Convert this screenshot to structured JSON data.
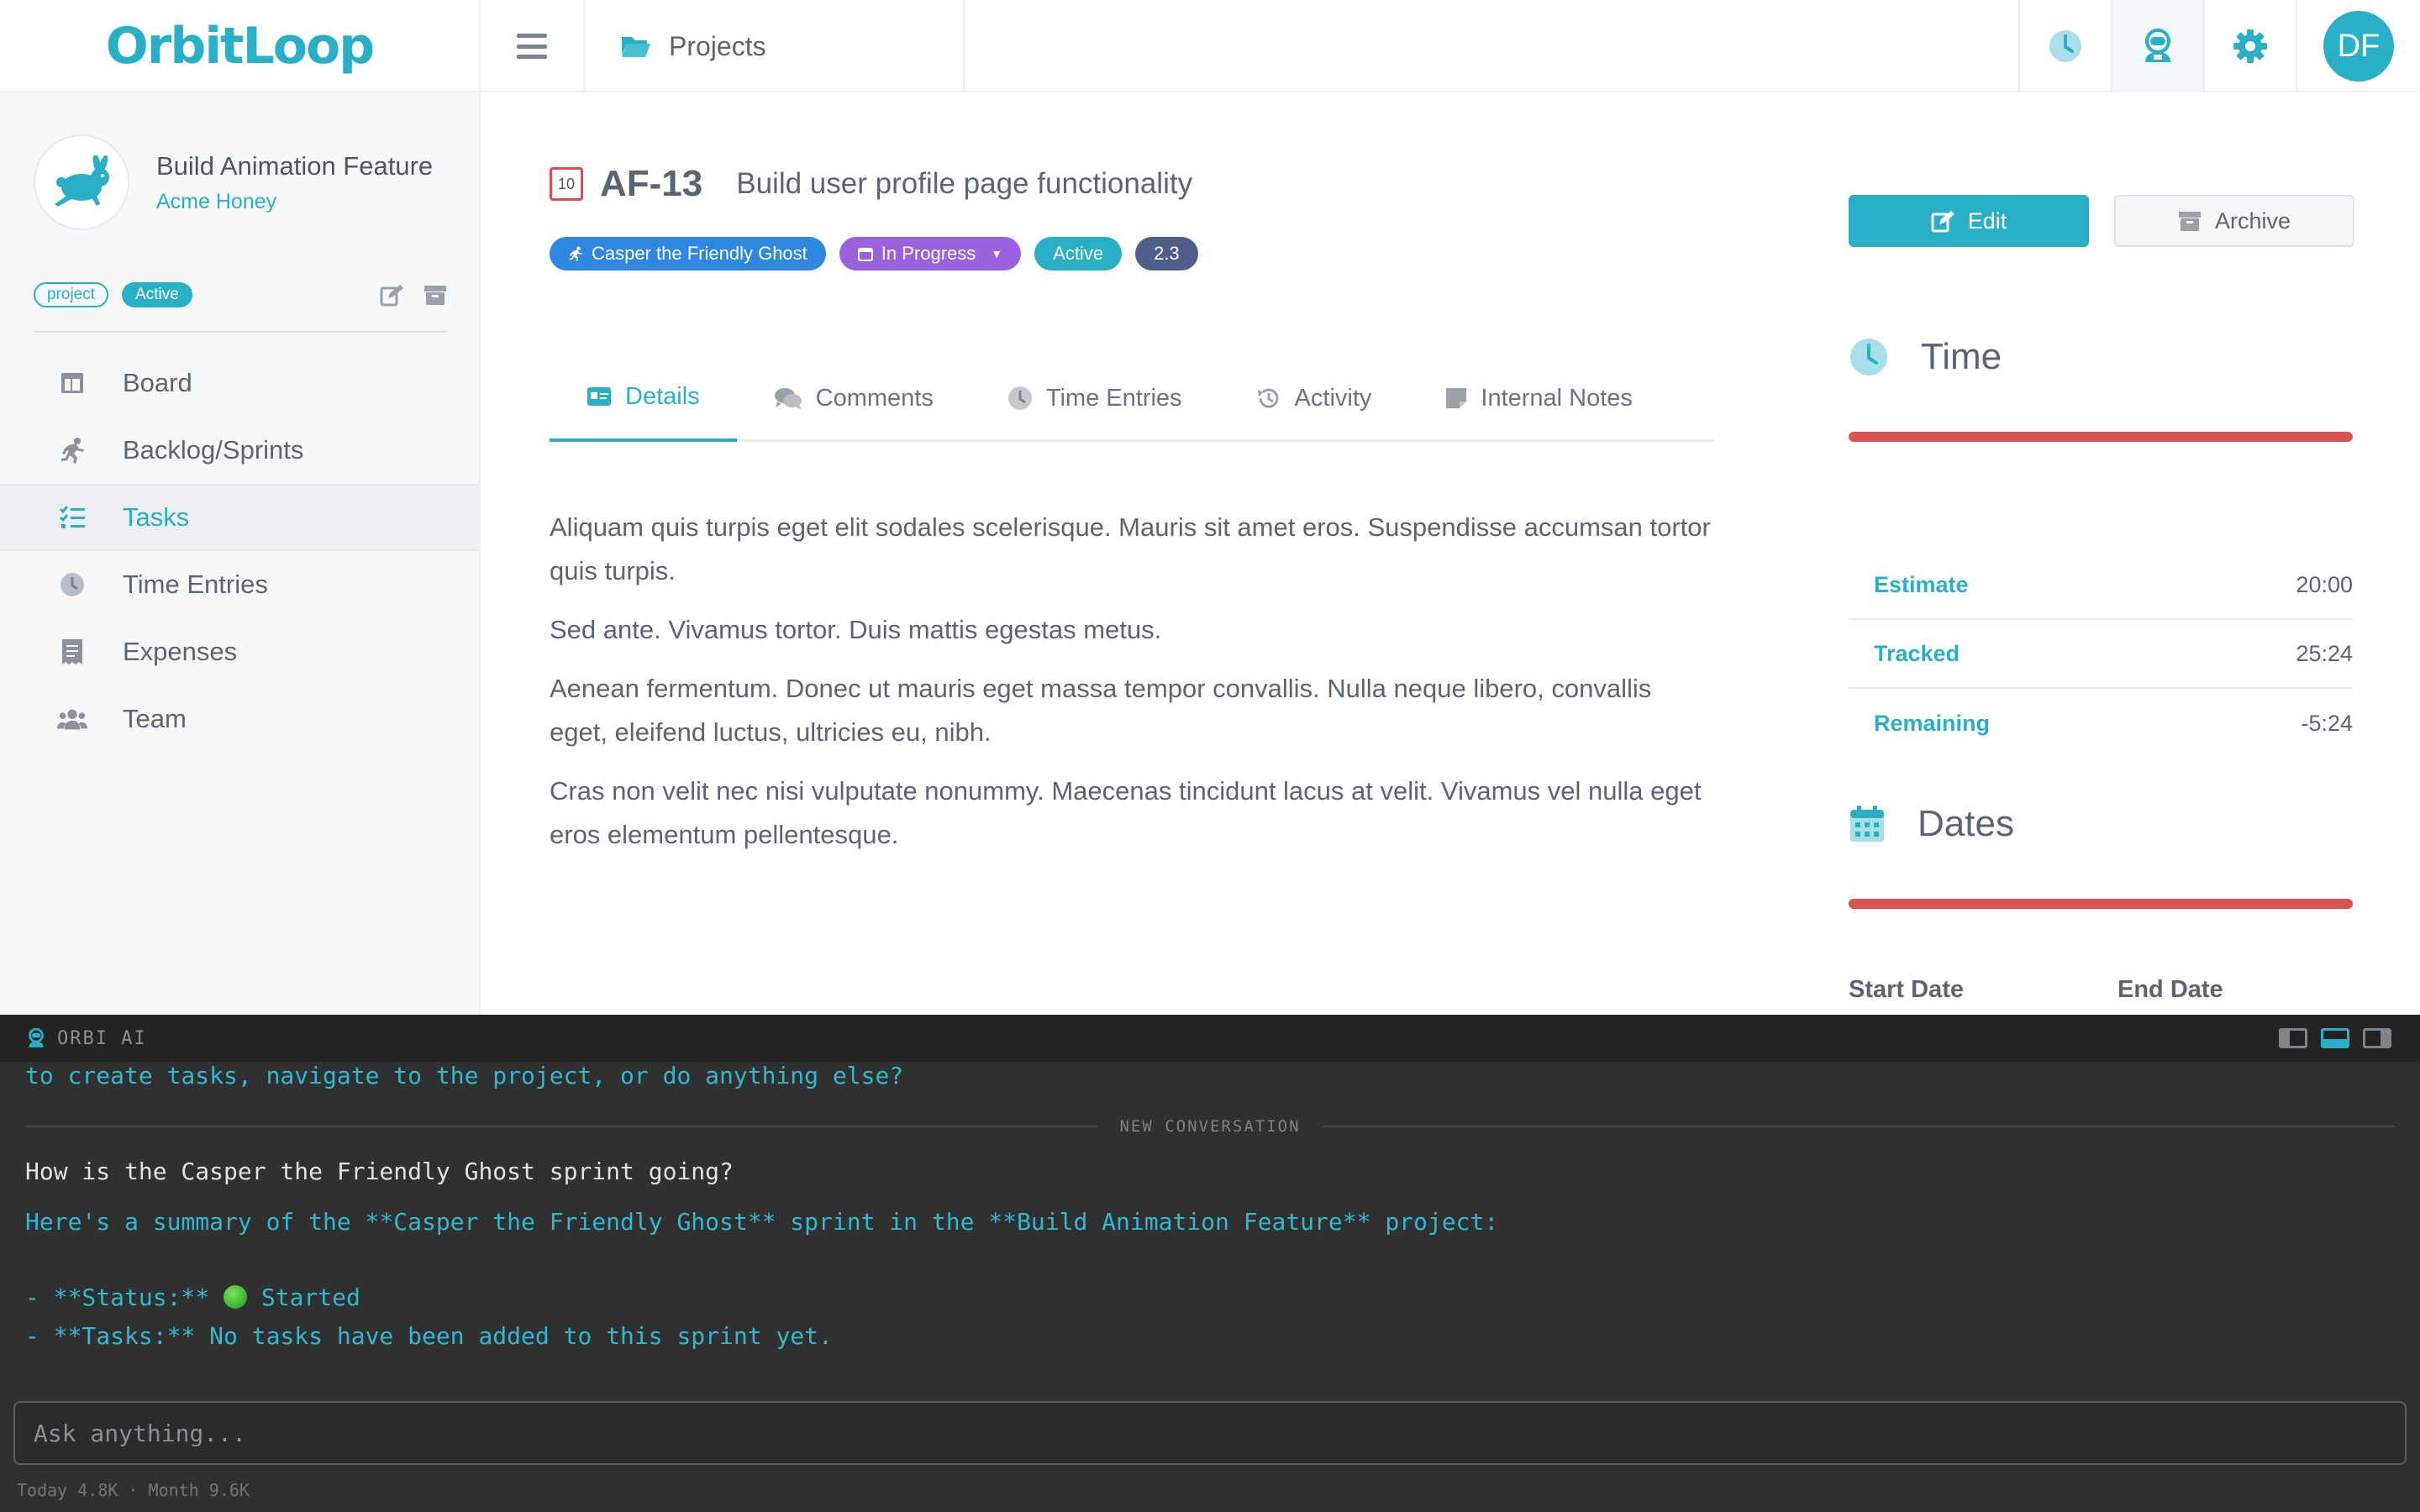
{
  "app": {
    "logo": "OrbitLoop"
  },
  "topbar": {
    "breadcrumb": "Projects",
    "icons": [
      "clock-icon",
      "astronaut-icon",
      "gear-icon"
    ],
    "avatar_initials": "DF"
  },
  "project": {
    "name": "Build Animation Feature",
    "client": "Acme Honey",
    "tag_type": "project",
    "tag_status": "Active"
  },
  "sidebar": {
    "items": [
      {
        "label": "Board",
        "icon": "board-icon"
      },
      {
        "label": "Backlog/Sprints",
        "icon": "running-icon"
      },
      {
        "label": "Tasks",
        "icon": "tasks-icon",
        "active": true
      },
      {
        "label": "Time Entries",
        "icon": "clock-icon"
      },
      {
        "label": "Expenses",
        "icon": "receipt-icon"
      },
      {
        "label": "Team",
        "icon": "team-icon"
      }
    ]
  },
  "task": {
    "priority": "10",
    "key": "AF-13",
    "title": "Build user profile page functionality",
    "sprint_badge": "Casper the Friendly Ghost",
    "status_badge": "In Progress",
    "active_badge": "Active",
    "points_badge": "2.3"
  },
  "tabs": [
    {
      "label": "Details",
      "active": true
    },
    {
      "label": "Comments"
    },
    {
      "label": "Time Entries"
    },
    {
      "label": "Activity"
    },
    {
      "label": "Internal Notes"
    }
  ],
  "description": [
    "Aliquam quis turpis eget elit sodales scelerisque. Mauris sit amet eros. Suspendisse accumsan tortor quis turpis.",
    "Sed ante. Vivamus tortor. Duis mattis egestas metus.",
    "Aenean fermentum. Donec ut mauris eget massa tempor convallis. Nulla neque libero, convallis eget, eleifend luctus, ultricies eu, nibh.",
    "Cras non velit nec nisi vulputate nonummy. Maecenas tincidunt lacus at velit. Vivamus vel nulla eget eros elementum pellentesque."
  ],
  "actions": {
    "edit": "Edit",
    "archive": "Archive"
  },
  "time_panel": {
    "title": "Time",
    "rows": [
      {
        "label": "Estimate",
        "value": "20:00"
      },
      {
        "label": "Tracked",
        "value": "25:24"
      },
      {
        "label": "Remaining",
        "value": "-5:24"
      }
    ]
  },
  "dates_panel": {
    "title": "Dates",
    "start_label": "Start Date",
    "end_label": "End Date"
  },
  "ai": {
    "brand": "ORBI AI",
    "prev_line": "to create tasks, navigate to the project, or do anything else?",
    "divider": "NEW CONVERSATION",
    "user_msg": "How is the Casper the Friendly Ghost sprint going?",
    "reply_line1": "Here's a summary of the **Casper the Friendly Ghost** sprint in the **Build Animation Feature** project:",
    "reply_status_prefix": "- **Status:** ",
    "reply_status_value": " Started",
    "reply_tasks": "- **Tasks:** No tasks have been added to this sprint yet.",
    "input_placeholder": "Ask anything...",
    "usage": "Today 4.8K · Month 9.6K"
  },
  "colors": {
    "accent": "#2ab0c6",
    "sprint_badge": "#2f87e0",
    "status_badge": "#9b62e0",
    "points_badge": "#4f5e8a",
    "time_bar": "#d9534f",
    "console_bg": "#303030"
  }
}
